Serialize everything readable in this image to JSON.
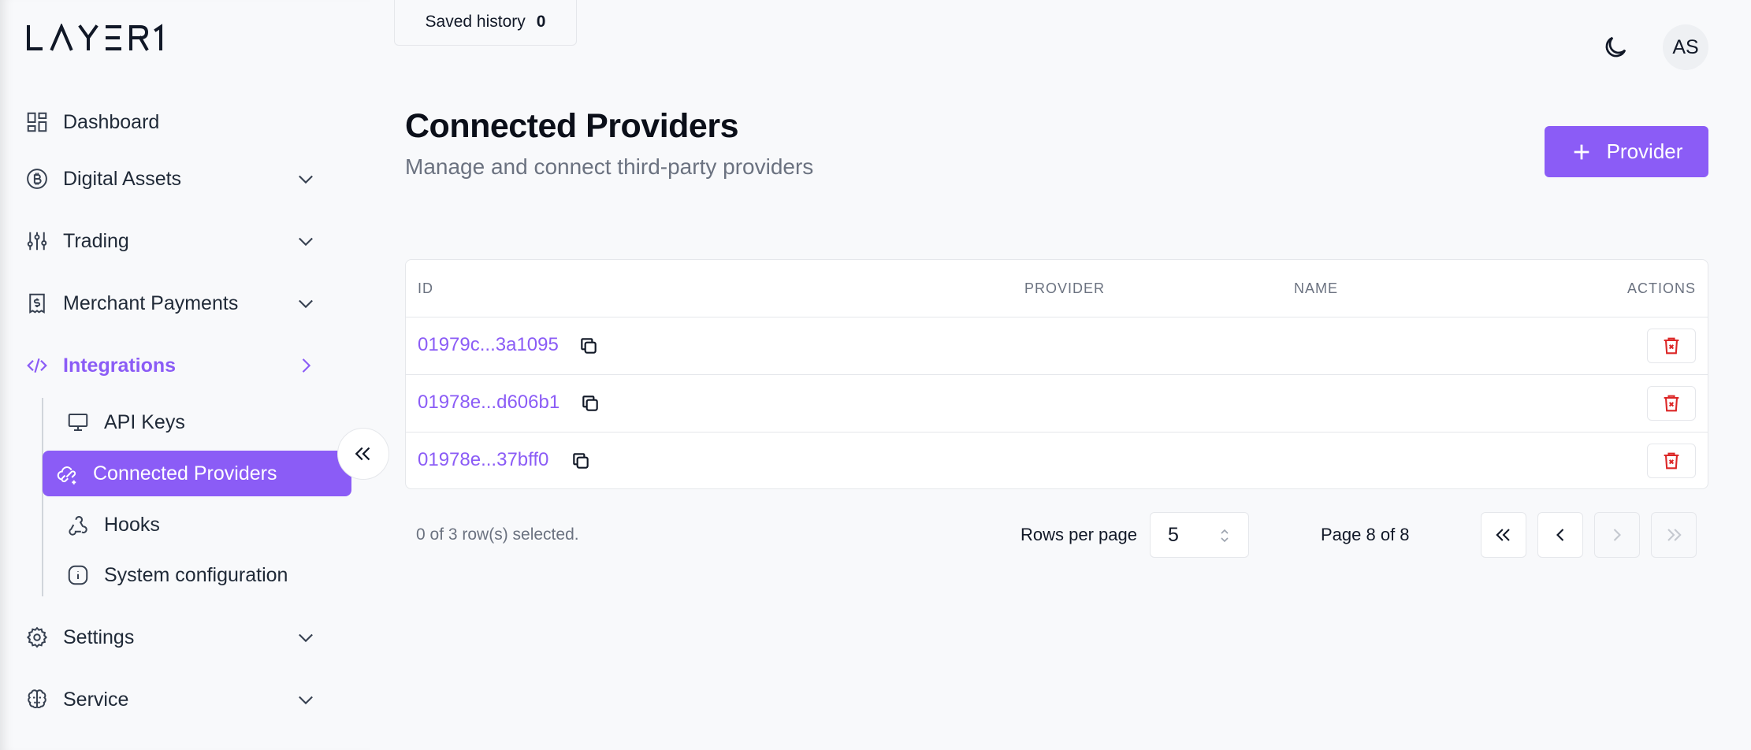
{
  "app": {
    "logo_text": "LAYER1",
    "saved_history": {
      "label": "Saved history",
      "count": "0"
    },
    "avatar_initials": "AS"
  },
  "sidebar": {
    "items": [
      {
        "label": "Dashboard",
        "icon": "dashboard-icon"
      },
      {
        "label": "Digital Assets",
        "icon": "bitcoin-icon"
      },
      {
        "label": "Trading",
        "icon": "sliders-icon"
      },
      {
        "label": "Merchant Payments",
        "icon": "receipt-icon"
      },
      {
        "label": "Integrations",
        "icon": "code-icon"
      },
      {
        "label": "Settings",
        "icon": "gear-icon"
      },
      {
        "label": "Service",
        "icon": "brain-icon"
      }
    ],
    "sub_items": [
      {
        "label": "API Keys",
        "icon": "monitor-icon"
      },
      {
        "label": "Connected Providers",
        "icon": "cloud-link-icon"
      },
      {
        "label": "Hooks",
        "icon": "webhook-icon"
      },
      {
        "label": "System configuration",
        "icon": "info-icon"
      }
    ],
    "accent_color": "#8b5cf6"
  },
  "main": {
    "title": "Connected Providers",
    "subtitle": "Manage and connect third-party providers",
    "add_button_label": "Provider",
    "table": {
      "columns": [
        "ID",
        "PROVIDER",
        "NAME",
        "ACTIONS"
      ],
      "rows": [
        {
          "id": "01979c...3a1095",
          "provider": "",
          "name": ""
        },
        {
          "id": "01978e...d606b1",
          "provider": "",
          "name": ""
        },
        {
          "id": "01978e...37bff0",
          "provider": "",
          "name": ""
        }
      ]
    },
    "footer": {
      "selected_text": "0 of 3 row(s) selected.",
      "rows_per_page_label": "Rows per page",
      "rows_per_page_value": "5",
      "page_info": "Page 8 of 8"
    }
  }
}
